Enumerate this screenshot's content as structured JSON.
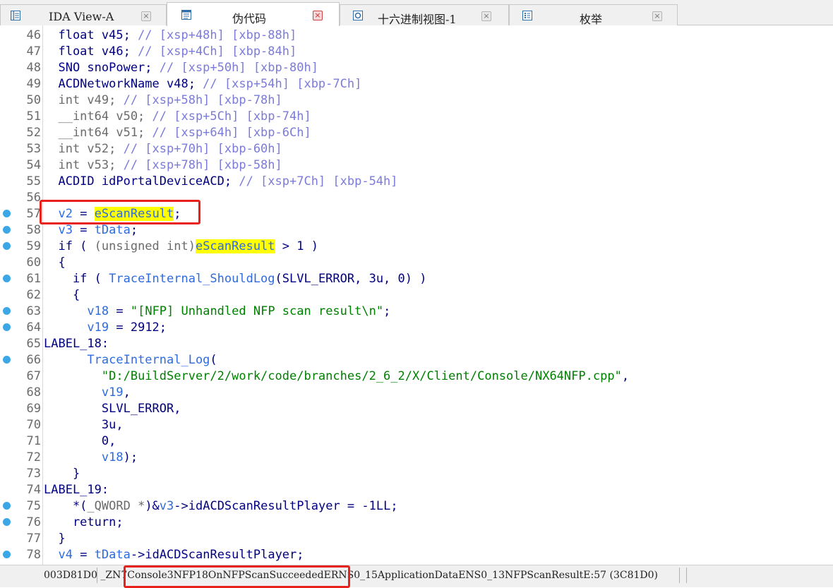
{
  "tabs": [
    {
      "label": "IDA View-A",
      "icon": "disassembly-view-icon",
      "active": false
    },
    {
      "label": "伪代码",
      "icon": "pseudocode-icon",
      "active": true
    },
    {
      "label": "十六进制视图-1",
      "icon": "hex-view-icon",
      "active": false
    },
    {
      "label": "枚举",
      "icon": "enums-icon",
      "active": false
    }
  ],
  "colors": {
    "keyword": "#000080",
    "comment": "#7b7bd9",
    "variable": "#2f6be0",
    "string": "#008000",
    "highlight": "#ffff00",
    "breakpoint": "#3ca7e6",
    "annotation_box": "#e8211c"
  },
  "code_lines": [
    {
      "num": "46",
      "bp": false,
      "segs": [
        [
          "  float v45; ",
          "k"
        ],
        [
          "// [xsp+48h] [xbp-88h]",
          "c"
        ]
      ]
    },
    {
      "num": "47",
      "bp": false,
      "segs": [
        [
          "  float v46; ",
          "k"
        ],
        [
          "// [xsp+4Ch] [xbp-84h]",
          "c"
        ]
      ]
    },
    {
      "num": "48",
      "bp": false,
      "segs": [
        [
          "  SNO snoPower; ",
          "k"
        ],
        [
          "// [xsp+50h] [xbp-80h]",
          "c"
        ]
      ]
    },
    {
      "num": "49",
      "bp": false,
      "segs": [
        [
          "  ACDNetworkName v48; ",
          "k"
        ],
        [
          "// [xsp+54h] [xbp-7Ch]",
          "c"
        ]
      ]
    },
    {
      "num": "50",
      "bp": false,
      "segs": [
        [
          "  int v49; ",
          "g"
        ],
        [
          "// [xsp+58h] [xbp-78h]",
          "c"
        ]
      ]
    },
    {
      "num": "51",
      "bp": false,
      "segs": [
        [
          "  __int64 v50; ",
          "g"
        ],
        [
          "// [xsp+5Ch] [xbp-74h]",
          "c"
        ]
      ]
    },
    {
      "num": "52",
      "bp": false,
      "segs": [
        [
          "  __int64 v51; ",
          "g"
        ],
        [
          "// [xsp+64h] [xbp-6Ch]",
          "c"
        ]
      ]
    },
    {
      "num": "53",
      "bp": false,
      "segs": [
        [
          "  int v52; ",
          "g"
        ],
        [
          "// [xsp+70h] [xbp-60h]",
          "c"
        ]
      ]
    },
    {
      "num": "54",
      "bp": false,
      "segs": [
        [
          "  int v53; ",
          "g"
        ],
        [
          "// [xsp+78h] [xbp-58h]",
          "c"
        ]
      ]
    },
    {
      "num": "55",
      "bp": false,
      "segs": [
        [
          "  ACDID idPortalDeviceACD; ",
          "k"
        ],
        [
          "// [xsp+7Ch] [xbp-54h]",
          "c"
        ]
      ]
    },
    {
      "num": "56",
      "bp": false,
      "segs": []
    },
    {
      "num": "57",
      "bp": true,
      "segs": [
        [
          "  ",
          "k"
        ],
        [
          "v2",
          "v"
        ],
        [
          " = ",
          "k"
        ],
        [
          "eScanResult",
          "h"
        ],
        [
          ";",
          "k"
        ]
      ]
    },
    {
      "num": "58",
      "bp": true,
      "segs": [
        [
          "  ",
          "k"
        ],
        [
          "v3",
          "v"
        ],
        [
          " = ",
          "k"
        ],
        [
          "tData",
          "v"
        ],
        [
          ";",
          "k"
        ]
      ]
    },
    {
      "num": "59",
      "bp": true,
      "segs": [
        [
          "  if ( ",
          "k"
        ],
        [
          "(unsigned int)",
          "g"
        ],
        [
          "eScanResult",
          "h"
        ],
        [
          " > 1 )",
          "k"
        ]
      ]
    },
    {
      "num": "60",
      "bp": false,
      "segs": [
        [
          "  {",
          "k"
        ]
      ]
    },
    {
      "num": "61",
      "bp": true,
      "segs": [
        [
          "    if ( ",
          "k"
        ],
        [
          "TraceInternal_ShouldLog",
          "v"
        ],
        [
          "(SLVL_ERROR, 3u, 0) )",
          "k"
        ]
      ]
    },
    {
      "num": "62",
      "bp": false,
      "segs": [
        [
          "    {",
          "k"
        ]
      ]
    },
    {
      "num": "63",
      "bp": true,
      "segs": [
        [
          "      ",
          "k"
        ],
        [
          "v18",
          "v"
        ],
        [
          " = ",
          "k"
        ],
        [
          "\"[NFP] Unhandled NFP scan result\\n\"",
          "s"
        ],
        [
          ";",
          "k"
        ]
      ]
    },
    {
      "num": "64",
      "bp": true,
      "segs": [
        [
          "      ",
          "k"
        ],
        [
          "v19",
          "v"
        ],
        [
          " = 2912;",
          "k"
        ]
      ]
    },
    {
      "num": "65",
      "bp": false,
      "segs": [
        [
          "LABEL_18:",
          "k"
        ]
      ]
    },
    {
      "num": "66",
      "bp": true,
      "segs": [
        [
          "      ",
          "k"
        ],
        [
          "TraceInternal_Log",
          "v"
        ],
        [
          "(",
          "k"
        ]
      ]
    },
    {
      "num": "67",
      "bp": false,
      "segs": [
        [
          "        ",
          "k"
        ],
        [
          "\"D:/BuildServer/2/work/code/branches/2_6_2/X/Client/Console/NX64NFP.cpp\"",
          "s"
        ],
        [
          ",",
          "k"
        ]
      ]
    },
    {
      "num": "68",
      "bp": false,
      "segs": [
        [
          "        ",
          "k"
        ],
        [
          "v19",
          "v"
        ],
        [
          ",",
          "k"
        ]
      ]
    },
    {
      "num": "69",
      "bp": false,
      "segs": [
        [
          "        SLVL_ERROR,",
          "k"
        ]
      ]
    },
    {
      "num": "70",
      "bp": false,
      "segs": [
        [
          "        3u,",
          "k"
        ]
      ]
    },
    {
      "num": "71",
      "bp": false,
      "segs": [
        [
          "        0,",
          "k"
        ]
      ]
    },
    {
      "num": "72",
      "bp": false,
      "segs": [
        [
          "        ",
          "k"
        ],
        [
          "v18",
          "v"
        ],
        [
          ");",
          "k"
        ]
      ]
    },
    {
      "num": "73",
      "bp": false,
      "segs": [
        [
          "    }",
          "k"
        ]
      ]
    },
    {
      "num": "74",
      "bp": false,
      "segs": [
        [
          "LABEL_19:",
          "k"
        ]
      ]
    },
    {
      "num": "75",
      "bp": true,
      "segs": [
        [
          "    *(",
          "k"
        ],
        [
          "_QWORD *",
          "g"
        ],
        [
          ")&",
          "k"
        ],
        [
          "v3",
          "v"
        ],
        [
          "->idACDScanResultPlayer = -1LL;",
          "k"
        ]
      ]
    },
    {
      "num": "76",
      "bp": true,
      "segs": [
        [
          "    return;",
          "k"
        ]
      ]
    },
    {
      "num": "77",
      "bp": false,
      "segs": [
        [
          "  }",
          "k"
        ]
      ]
    },
    {
      "num": "78",
      "bp": true,
      "segs": [
        [
          "  ",
          "k"
        ],
        [
          "v4",
          "v"
        ],
        [
          " = ",
          "k"
        ],
        [
          "tData",
          "v"
        ],
        [
          "->idACDScanResultPlayer;",
          "k"
        ]
      ]
    }
  ],
  "statusbar": {
    "address": "003D81D0",
    "function_location": "_ZN7Console3NFP18OnNFPScanSucceededERNS0_15ApplicationDataENS0_13NFPScanResultE:57 (3C81D0)"
  }
}
